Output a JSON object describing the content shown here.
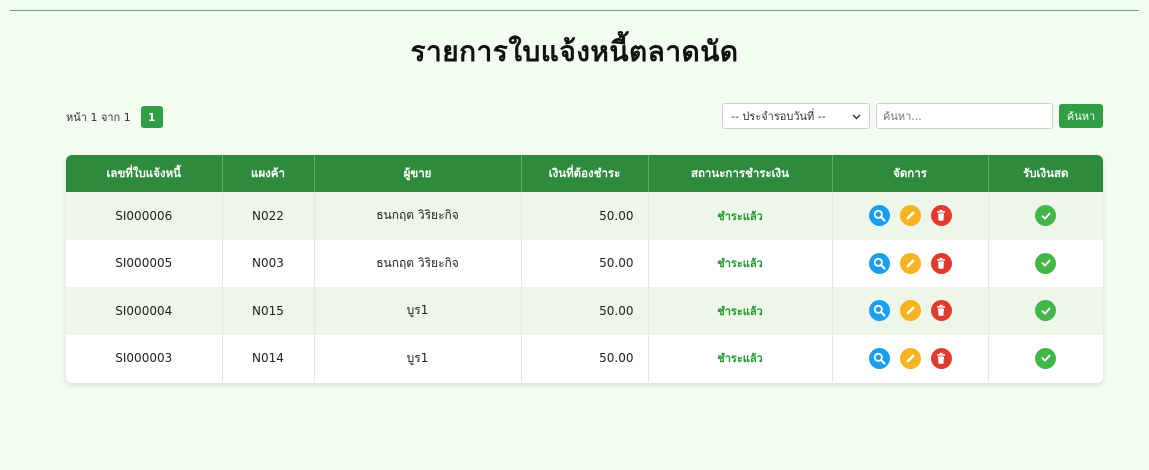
{
  "title": "รายการใบแจ้งหนี้ตลาดนัด",
  "pagination": {
    "text": "หน้า 1 จาก 1",
    "current": "1"
  },
  "filter": {
    "selected": "-- ประจำรอบวันที่ --"
  },
  "search": {
    "placeholder": "ค้นหา...",
    "button": "ค้นหา"
  },
  "table": {
    "headers": [
      "เลขที่ใบแจ้งหนี้",
      "แผงค้า",
      "ผู้ขาย",
      "เงินที่ต้องชำระ",
      "สถานะการชำระเงิน",
      "จัดการ",
      "รับเงินสด"
    ],
    "rows": [
      {
        "invoice": "SI000006",
        "stall": "N022",
        "seller": "ธนกฤต วิริยะกิจ",
        "amount": "50.00",
        "status": "ชำระแล้ว"
      },
      {
        "invoice": "SI000005",
        "stall": "N003",
        "seller": "ธนกฤต วิริยะกิจ",
        "amount": "50.00",
        "status": "ชำระแล้ว"
      },
      {
        "invoice": "SI000004",
        "stall": "N015",
        "seller": "บูร1",
        "amount": "50.00",
        "status": "ชำระแล้ว"
      },
      {
        "invoice": "SI000003",
        "stall": "N014",
        "seller": "บูร1",
        "amount": "50.00",
        "status": "ชำระแล้ว"
      }
    ]
  },
  "icons": {
    "view": "search-icon",
    "edit": "pencil-icon",
    "delete": "trash-icon",
    "cash": "check-icon"
  },
  "colors": {
    "primary": "#2e8b3d",
    "paid": "#1e9a2c",
    "view": "#1c9ef0",
    "edit": "#f6b321",
    "delete": "#e23b2e",
    "cash": "#43b649"
  }
}
